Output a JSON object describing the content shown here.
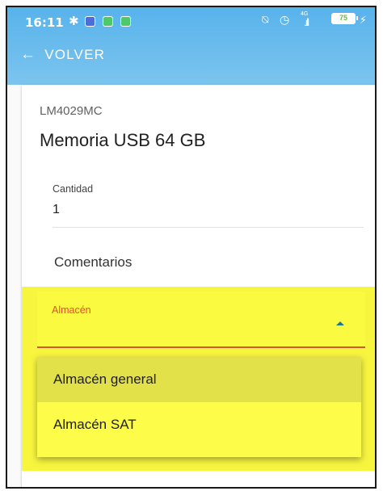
{
  "status_bar": {
    "time": "16:11",
    "network": "4G",
    "battery": "75",
    "icons": [
      "bluetooth-icon",
      "app-icon",
      "app-icon",
      "app-icon",
      "mute-icon",
      "alarm-icon",
      "signal-icon",
      "battery-icon",
      "charging-icon"
    ]
  },
  "appbar": {
    "back_label": "VOLVER"
  },
  "product": {
    "code": "LM4029MC",
    "name": "Memoria USB 64 GB"
  },
  "fields": {
    "quantity": {
      "label": "Cantidad",
      "value": "1"
    },
    "comments": {
      "label": "Comentarios"
    },
    "warehouse": {
      "label": "Almacén",
      "options": [
        "Almacén general",
        "Almacén SAT"
      ],
      "highlighted": "Almacén general"
    }
  },
  "colors": {
    "appbar": "#57b3eb",
    "highlight": "#f8f53f",
    "select_underline": "#d4572a",
    "select_label": "#e0502a",
    "caret": "#1e7a8a"
  }
}
